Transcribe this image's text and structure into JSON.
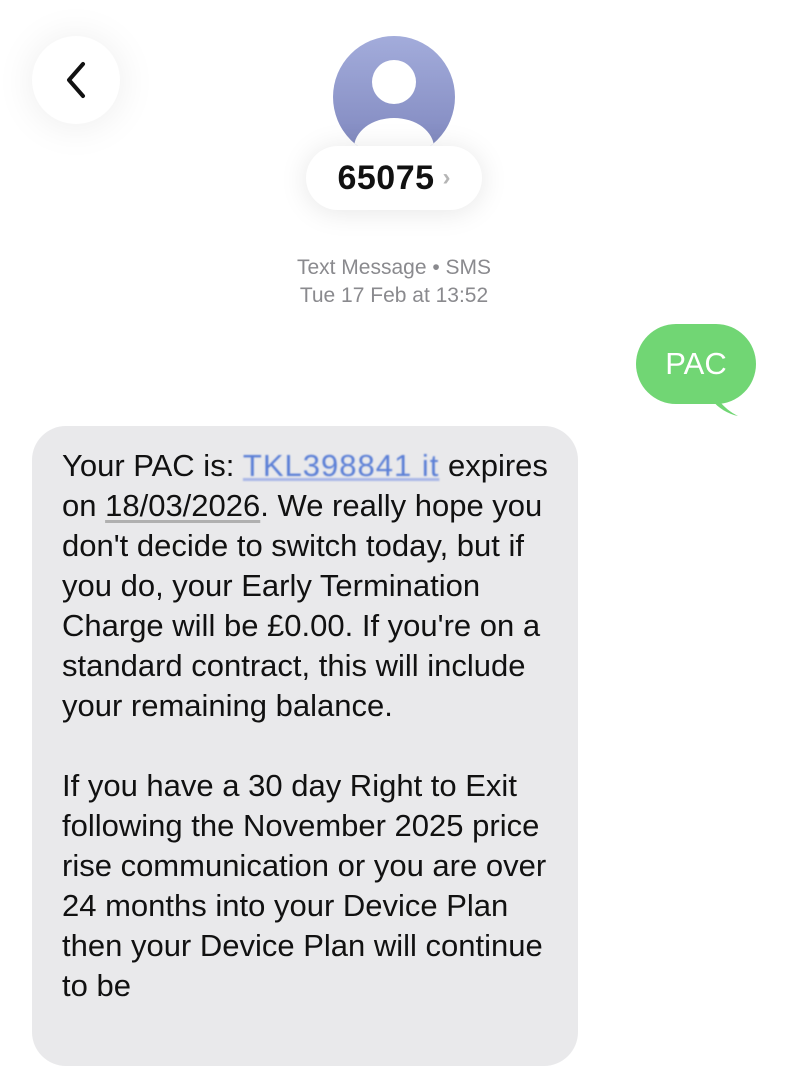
{
  "header": {
    "contact_name": "65075",
    "chevron": "›",
    "back_icon": "chevron-left-icon",
    "avatar_icon": "person-icon"
  },
  "meta": {
    "line1": "Text Message • SMS",
    "line2": "Tue 17 Feb at 13:52"
  },
  "sent_message": {
    "text": "PAC",
    "color": "#71d674"
  },
  "received_message": {
    "p1_prefix": "Your PAC is: ",
    "p1_code": "TKL398841 it",
    "p1_mid": " expires on ",
    "p1_date": "18/03/2026",
    "p1_rest": ". We really hope you don't decide to switch today, but if you do, your Early Termination Charge will be £0.00. If you're on a standard contract, this will include your remaining balance.",
    "p2": "If you have a 30 day Right to Exit following the November 2025 price rise communication or you are over 24 months into your Device Plan then your Device Plan will continue to be"
  }
}
